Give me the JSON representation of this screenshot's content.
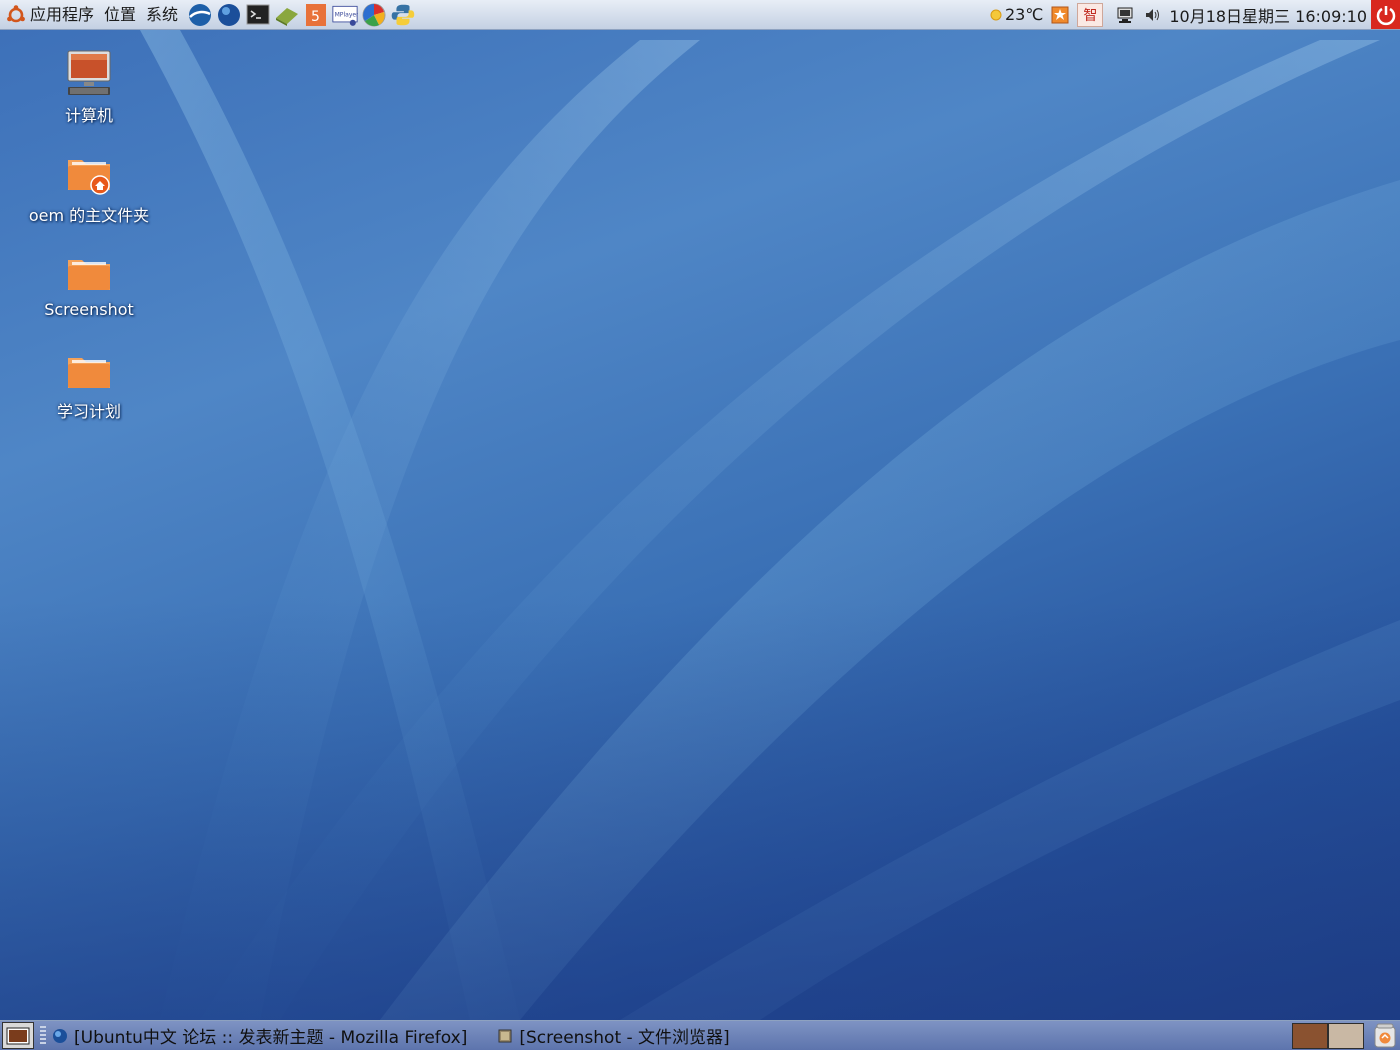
{
  "top_panel": {
    "menus": [
      {
        "label": "应用程序"
      },
      {
        "label": "位置"
      },
      {
        "label": "系统"
      }
    ],
    "launchers": [
      {
        "name": "web-browser-icon",
        "color": "#1d5fa8"
      },
      {
        "name": "firefox-globe-icon",
        "color": "#1b4f9a"
      },
      {
        "name": "terminal-icon",
        "color": "#1f1f1f"
      },
      {
        "name": "books-icon",
        "color": "#7a9a3a"
      },
      {
        "name": "text-editor-icon",
        "color": "#e8723a"
      },
      {
        "name": "mplayer-icon",
        "color": "#3a4a9a"
      },
      {
        "name": "picasa-icon",
        "color": "#d9302c"
      },
      {
        "name": "python-icon",
        "color": "#3672a4"
      }
    ],
    "tray": {
      "temperature": "23℃",
      "input_method": "智",
      "clock": "10月18日星期三 16:09:10"
    }
  },
  "desktop": {
    "icons": [
      {
        "name": "computer",
        "label": "计算机"
      },
      {
        "name": "home-folder",
        "label": "oem 的主文件夹"
      },
      {
        "name": "folder-screenshot",
        "label": "Screenshot"
      },
      {
        "name": "folder-study-plan",
        "label": "学习计划"
      }
    ]
  },
  "bottom_panel": {
    "tasks": [
      {
        "label": "[Ubuntu中文 论坛 :: 发表新主题 - Mozilla Firefox]"
      },
      {
        "label": "[Screenshot - 文件浏览器]"
      }
    ],
    "workspace_colors": [
      "#8a5230",
      "#c9b8a4"
    ]
  },
  "colors": {
    "folder_orange": "#f08a3c",
    "power_red": "#d8281e"
  }
}
